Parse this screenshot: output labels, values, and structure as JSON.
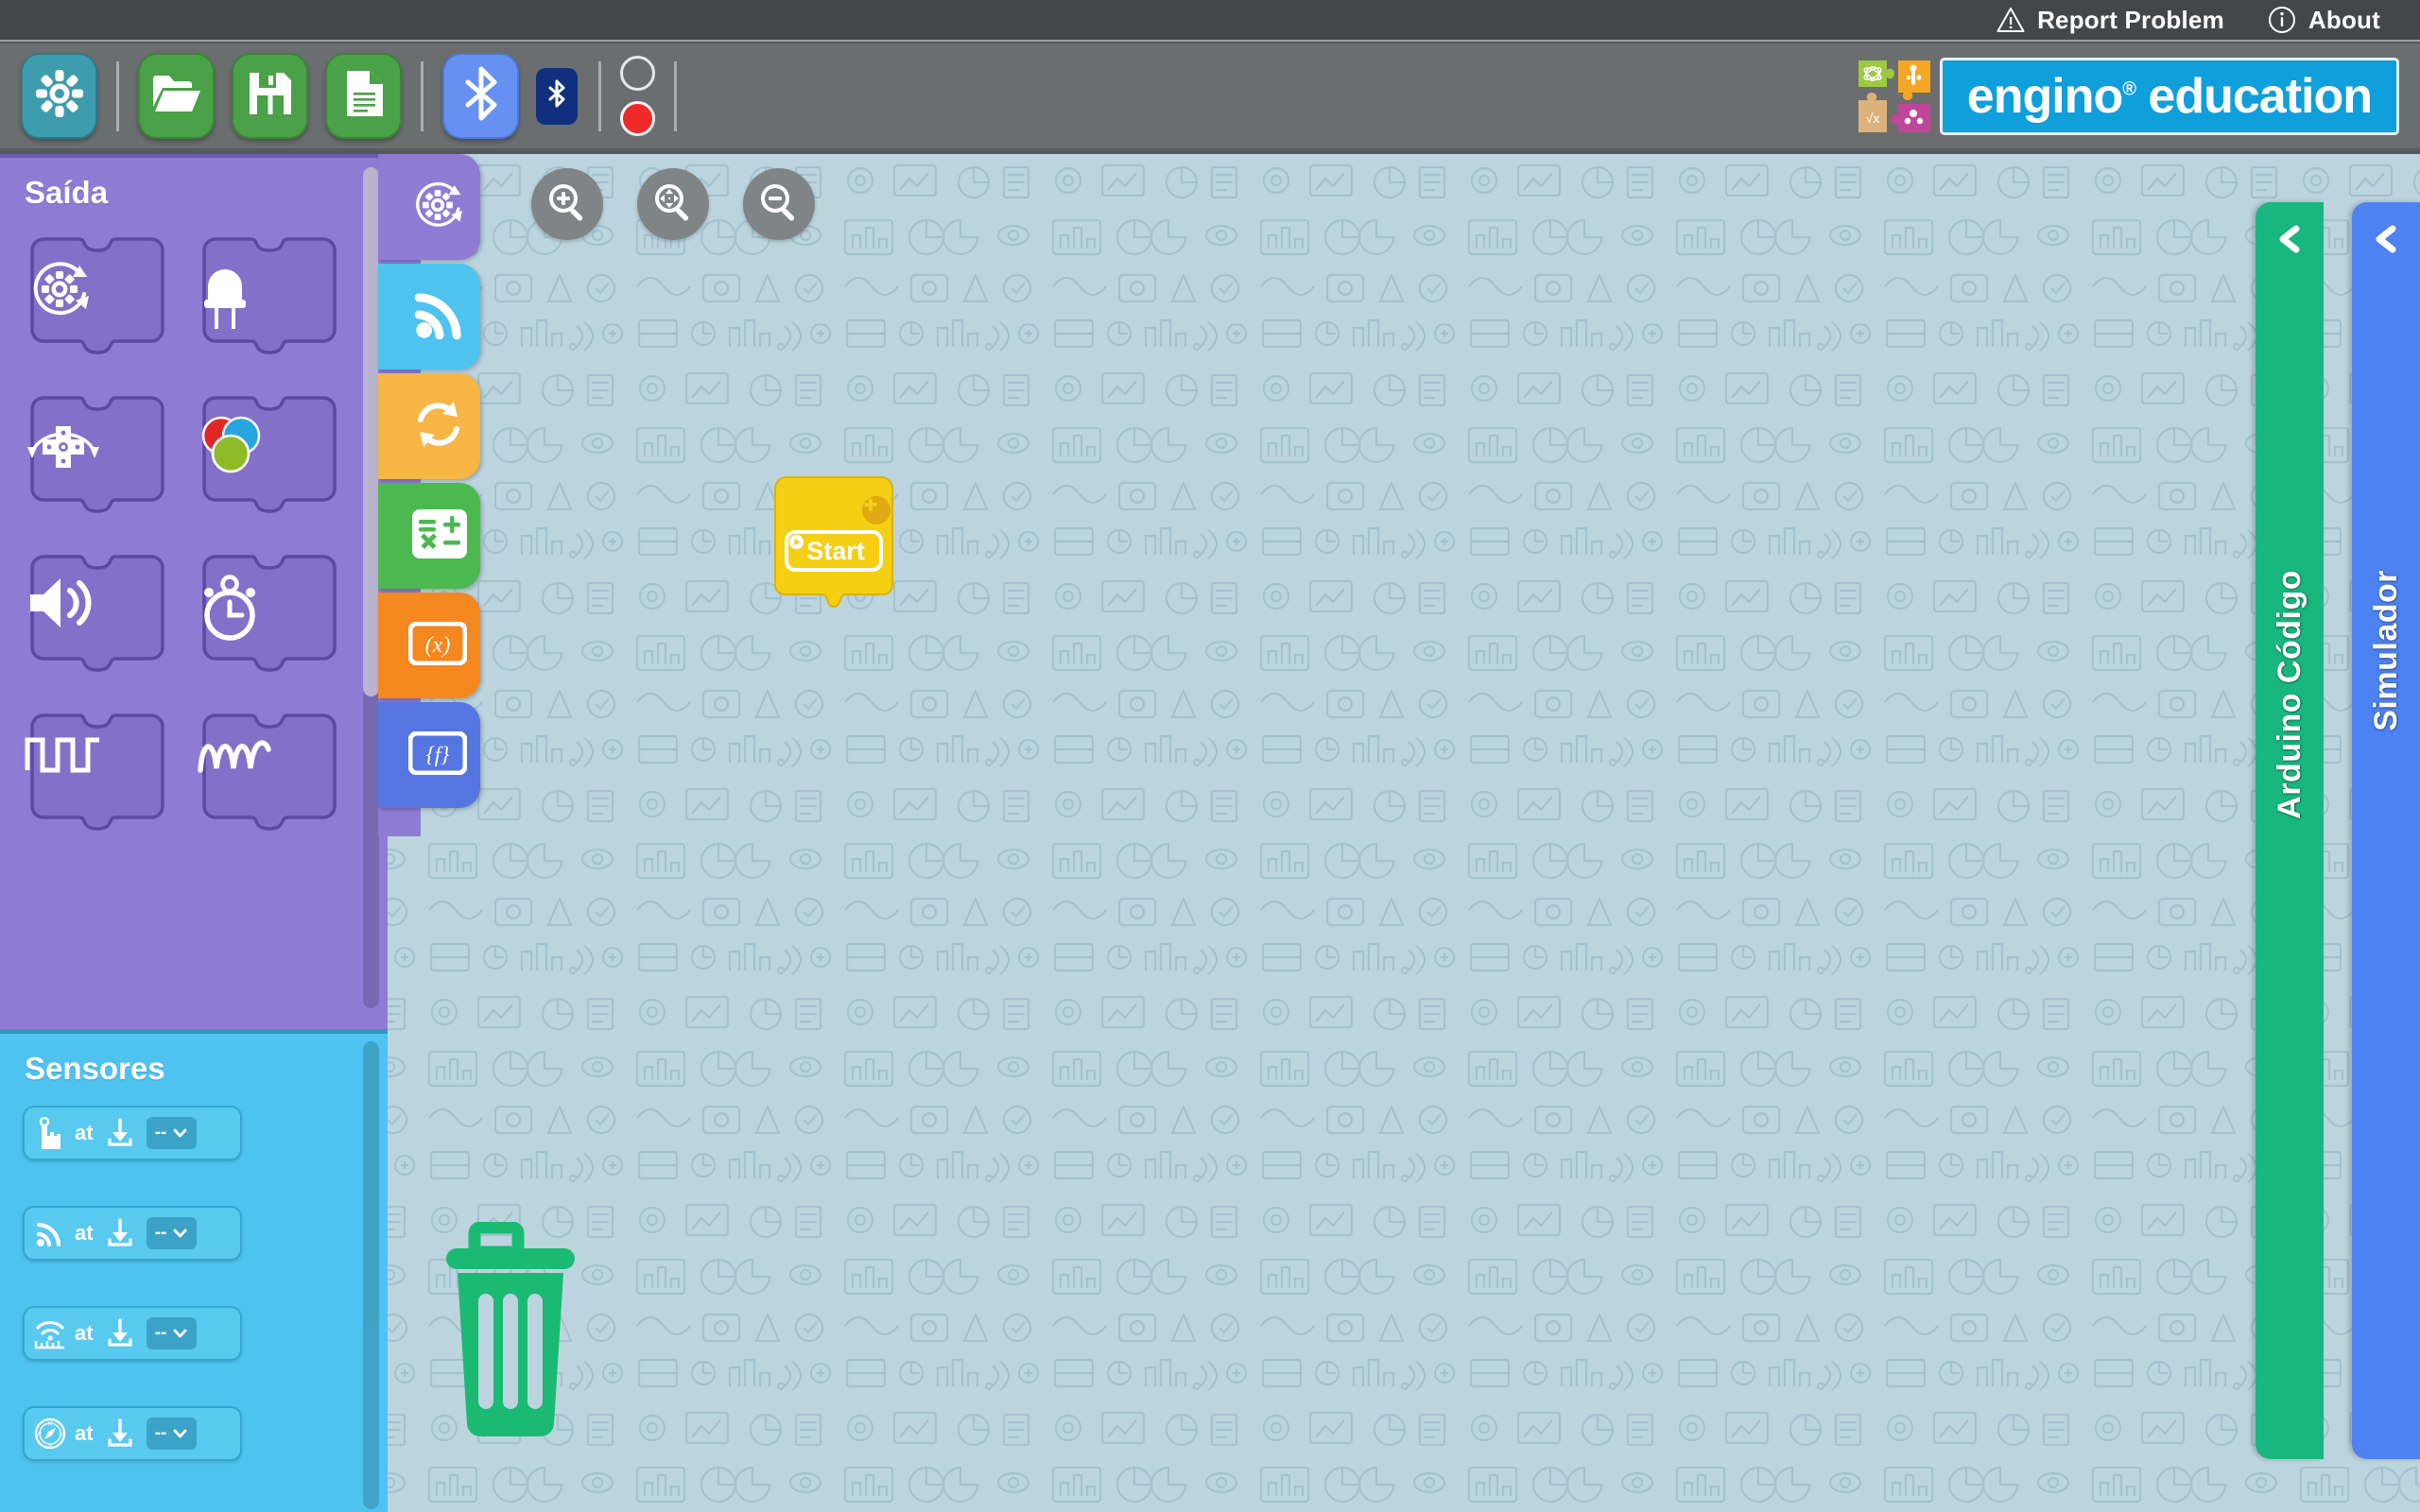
{
  "topbar": {
    "items": [
      {
        "label": "Report Problem",
        "icon": "warning-triangle-icon"
      },
      {
        "label": "About",
        "icon": "info-circle-icon"
      }
    ]
  },
  "toolbar": {
    "buttons": [
      {
        "name": "settings-button",
        "icon": "gear-icon",
        "color": "#3d9dae"
      },
      {
        "name": "open-button",
        "icon": "folder-open-icon",
        "color": "#4aa147"
      },
      {
        "name": "save-button",
        "icon": "floppy-save-icon",
        "color": "#4aa147"
      },
      {
        "name": "new-document-button",
        "icon": "document-icon",
        "color": "#4aa147"
      },
      {
        "name": "bluetooth-button",
        "icon": "bluetooth-icon",
        "color": "#6691f2"
      }
    ],
    "bluetooth_badge": {
      "name": "bluetooth-status-badge",
      "icon": "bluetooth-icon",
      "color": "#10307f"
    },
    "status": [
      {
        "name": "connection-status-indicator",
        "state": "off",
        "color": "#ffffff"
      },
      {
        "name": "record-status-indicator",
        "state": "on",
        "color": "#ee2a2a"
      }
    ]
  },
  "brand": {
    "text": "engino",
    "registered": "®",
    "suffix": " education",
    "plate_color": "#0f9fdb",
    "puzzle_colors": [
      "#9cc93f",
      "#f5a623",
      "#dcb27a",
      "#c0469a"
    ]
  },
  "palette": {
    "output": {
      "title": "Saída",
      "color": "#8e7cd4",
      "blocks": [
        {
          "name": "block-motor",
          "icon": "motor-rotation-icon"
        },
        {
          "name": "block-led",
          "icon": "led-icon"
        },
        {
          "name": "block-servo",
          "icon": "servo-cross-icon"
        },
        {
          "name": "block-rgb-led",
          "icon": "rgb-circles-icon"
        },
        {
          "name": "block-sound",
          "icon": "speaker-icon"
        },
        {
          "name": "block-timer",
          "icon": "stopwatch-icon"
        },
        {
          "name": "block-digital-output",
          "icon": "square-wave-icon"
        },
        {
          "name": "block-analog-output",
          "icon": "sine-wave-icon"
        }
      ]
    },
    "sensors": {
      "title": "Sensores",
      "color": "#4ec3f0",
      "at_label": "at",
      "select_value": "--",
      "blocks": [
        {
          "name": "sensor-touch",
          "icon": "touch-button-icon"
        },
        {
          "name": "sensor-signal",
          "icon": "signal-wave-icon"
        },
        {
          "name": "sensor-ultrasonic",
          "icon": "ultrasonic-ruler-icon"
        },
        {
          "name": "sensor-compass",
          "icon": "compass-icon"
        }
      ]
    }
  },
  "category_tabs": [
    {
      "name": "tab-output",
      "icon": "motor-rotation-icon",
      "color": "#8e7cd4"
    },
    {
      "name": "tab-sensors",
      "icon": "signal-wave-icon",
      "color": "#4ec3f0"
    },
    {
      "name": "tab-loops",
      "icon": "refresh-loop-icon",
      "color": "#f7b544"
    },
    {
      "name": "tab-math",
      "icon": "math-operators-icon",
      "color": "#4cb850"
    },
    {
      "name": "tab-variables",
      "icon": "variable-x-icon",
      "color": "#f5871f"
    },
    {
      "name": "tab-functions",
      "icon": "function-f-icon",
      "color": "#5575e0"
    }
  ],
  "zoom_controls": [
    {
      "name": "zoom-in-button",
      "icon": "magnifier-plus-icon"
    },
    {
      "name": "zoom-fit-button",
      "icon": "magnifier-move-icon"
    },
    {
      "name": "zoom-out-button",
      "icon": "magnifier-minus-icon"
    }
  ],
  "canvas": {
    "background_color": "#bcd4de",
    "start_block": {
      "label": "Start",
      "color": "#f5cf14",
      "play_icon": "play-icon",
      "add_icon": "plus-icon"
    },
    "trash": {
      "name": "trash-can",
      "icon": "trash-icon",
      "color": "#1aba73"
    }
  },
  "side_tabs": [
    {
      "name": "tab-arduino-code",
      "label": "Arduino Código",
      "color": "#18b77f",
      "chevron": "chevron-left-icon"
    },
    {
      "name": "tab-simulator",
      "label": "Simulador",
      "color": "#4d82f3",
      "chevron": "chevron-left-icon"
    }
  ]
}
